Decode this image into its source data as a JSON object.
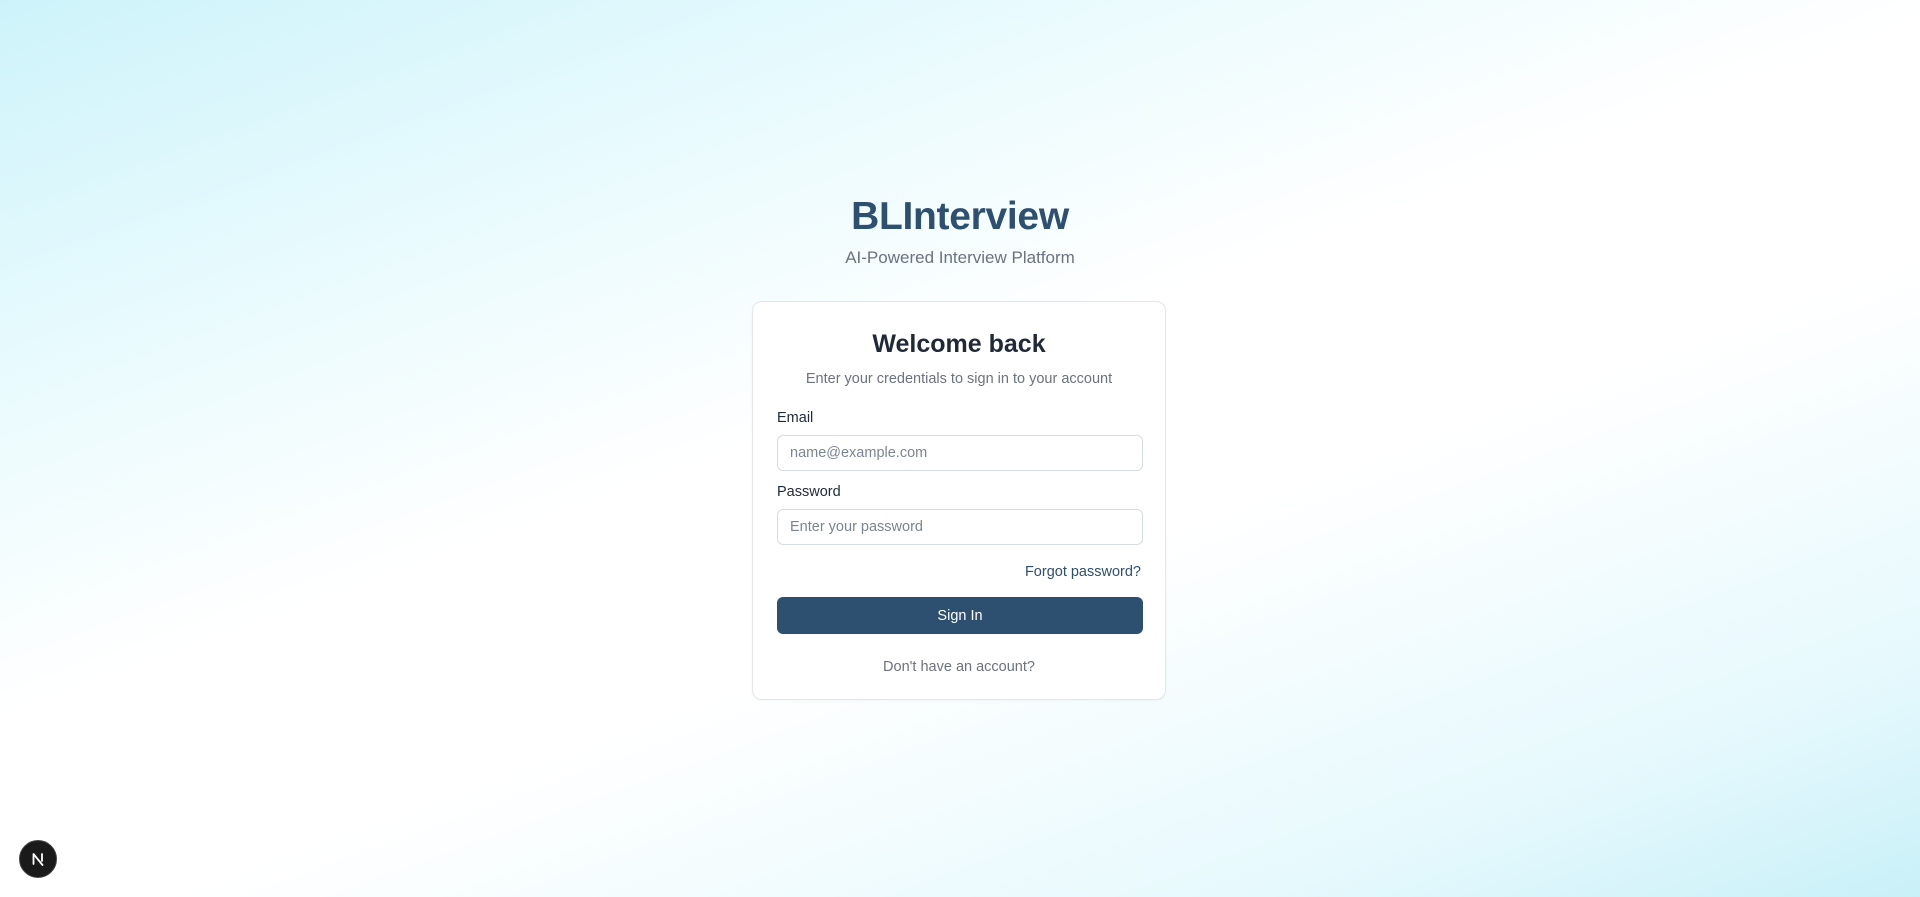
{
  "brand": {
    "title": "BLInterview",
    "subtitle": "AI-Powered Interview Platform"
  },
  "login_card": {
    "title": "Welcome back",
    "description": "Enter your credentials to sign in to your account",
    "email": {
      "label": "Email",
      "value": "",
      "placeholder": "name@example.com"
    },
    "password": {
      "label": "Password",
      "value": "",
      "placeholder": "Enter your password"
    },
    "forgot_password_label": "Forgot password?",
    "sign_in_label": "Sign In",
    "signup_prompt": "Don't have an account?"
  },
  "dev_indicator": {
    "icon": "nextjs-logo-icon"
  },
  "colors": {
    "brand": "#2d5071",
    "muted_text": "#6b7280",
    "background_tint": "#cdf3fa"
  }
}
